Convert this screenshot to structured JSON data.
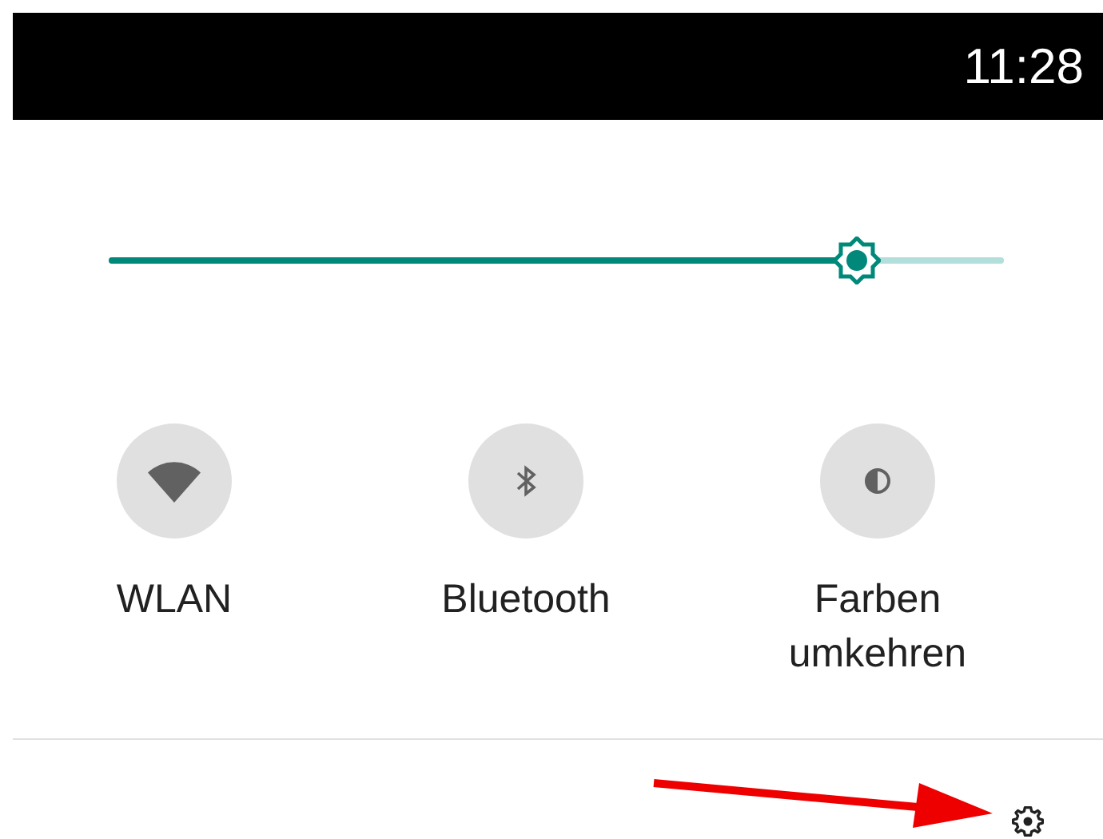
{
  "status_bar": {
    "time": "11:28"
  },
  "brightness": {
    "level": 0.836
  },
  "tiles": [
    {
      "kind": "wifi",
      "label": "WLAN",
      "on": false
    },
    {
      "kind": "bluetooth",
      "label": "Bluetooth",
      "on": false
    },
    {
      "kind": "invert",
      "label": "Farben umkehren",
      "on": false
    }
  ]
}
